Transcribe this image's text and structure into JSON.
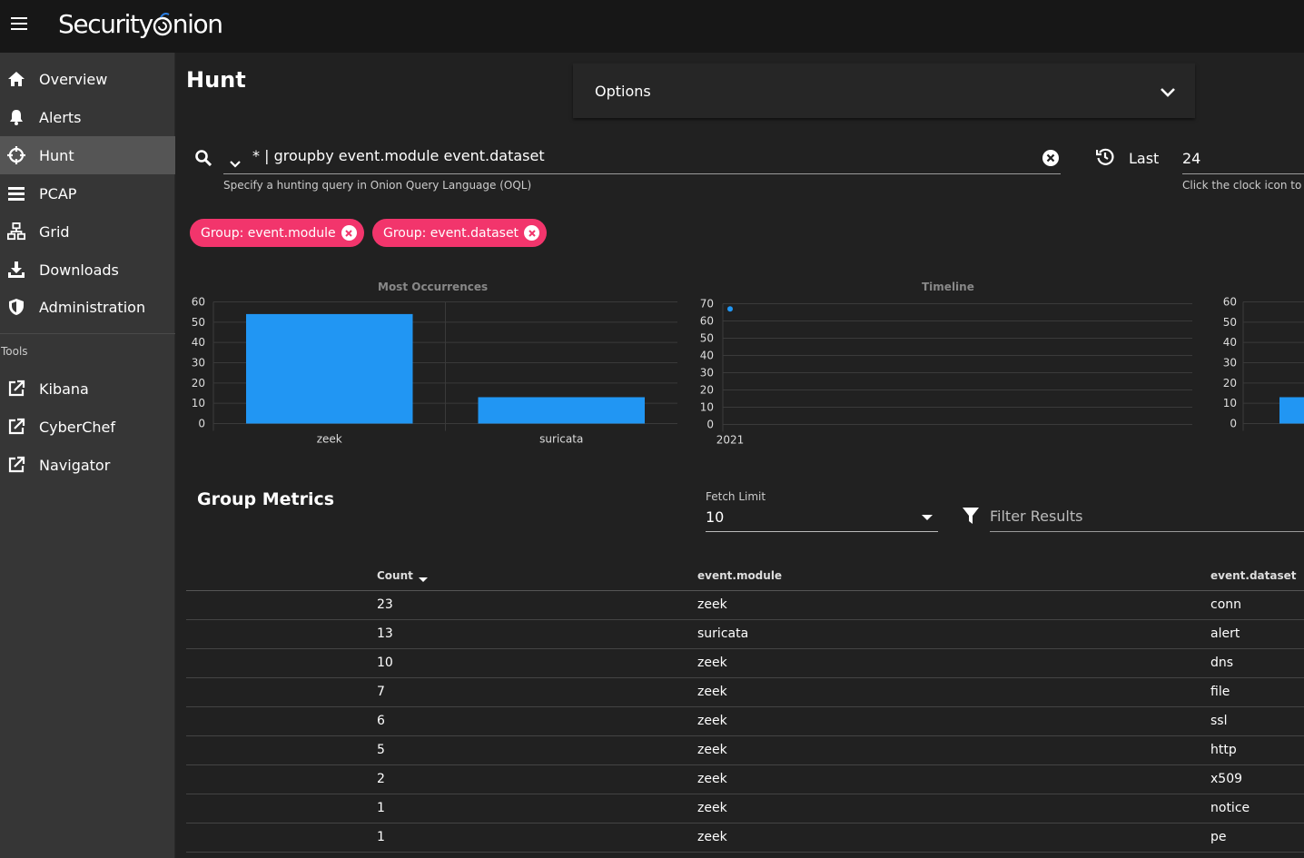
{
  "app": {
    "logo_text_1": "Security",
    "logo_text_2": "nion"
  },
  "sidebar": {
    "items": [
      {
        "label": "Overview",
        "icon": "home-icon"
      },
      {
        "label": "Alerts",
        "icon": "bell-icon"
      },
      {
        "label": "Hunt",
        "icon": "crosshairs-icon",
        "active": true
      },
      {
        "label": "PCAP",
        "icon": "list-icon"
      },
      {
        "label": "Grid",
        "icon": "sitemap-icon"
      },
      {
        "label": "Downloads",
        "icon": "download-icon"
      },
      {
        "label": "Administration",
        "icon": "shield-icon"
      }
    ],
    "tools_label": "Tools",
    "tools": [
      {
        "label": "Kibana",
        "icon": "external-link-icon"
      },
      {
        "label": "CyberChef",
        "icon": "external-link-icon"
      },
      {
        "label": "Navigator",
        "icon": "external-link-icon"
      }
    ]
  },
  "main": {
    "title": "Hunt",
    "options_label": "Options",
    "query": "* | groupby event.module event.dataset",
    "query_hint": "Specify a hunting query in Onion Query Language (OQL)",
    "last_label": "Last",
    "last_value": "24",
    "last_hint": "Click the clock icon to",
    "chips": [
      "Group: event.module",
      "Group: event.dataset"
    ]
  },
  "chart_data": [
    {
      "type": "bar",
      "title": "Most Occurrences",
      "categories": [
        "zeek",
        "suricata"
      ],
      "values": [
        54,
        13
      ],
      "yticks": [
        "60",
        "50",
        "40",
        "30",
        "20",
        "10",
        "0"
      ],
      "ylim": [
        0,
        60
      ],
      "color": "#2196f3"
    },
    {
      "type": "scatter",
      "title": "Timeline",
      "x": [
        "2021"
      ],
      "y": [
        67
      ],
      "yticks": [
        "70",
        "60",
        "50",
        "40",
        "30",
        "20",
        "10",
        "0"
      ],
      "ylim": [
        0,
        70
      ],
      "color": "#2196f3"
    },
    {
      "type": "bar",
      "title": "",
      "values": [
        13
      ],
      "yticks": [
        "60",
        "50",
        "40",
        "30",
        "20",
        "10",
        "0"
      ],
      "ylim": [
        0,
        60
      ],
      "color": "#2196f3"
    }
  ],
  "group_metrics": {
    "title": "Group Metrics",
    "fetch_limit_label": "Fetch Limit",
    "fetch_limit_value": "10",
    "filter_placeholder": "Filter Results",
    "columns": [
      "Count",
      "event.module",
      "event.dataset"
    ],
    "rows": [
      [
        "23",
        "zeek",
        "conn"
      ],
      [
        "13",
        "suricata",
        "alert"
      ],
      [
        "10",
        "zeek",
        "dns"
      ],
      [
        "7",
        "zeek",
        "file"
      ],
      [
        "6",
        "zeek",
        "ssl"
      ],
      [
        "5",
        "zeek",
        "http"
      ],
      [
        "2",
        "zeek",
        "x509"
      ],
      [
        "1",
        "zeek",
        "notice"
      ],
      [
        "1",
        "zeek",
        "pe"
      ]
    ]
  }
}
